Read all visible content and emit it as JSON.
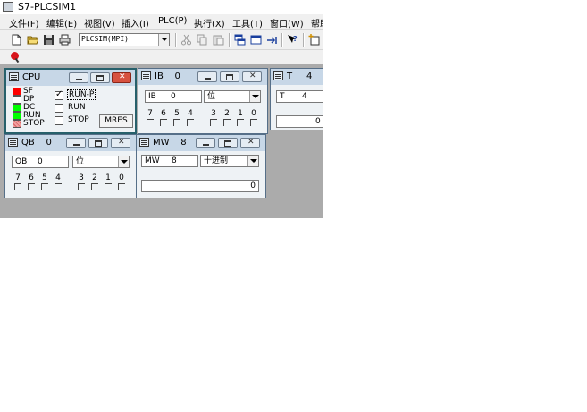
{
  "app": {
    "title": "S7-PLCSIM1",
    "menu": [
      "文件(F)",
      "编辑(E)",
      "视图(V)",
      "插入(I)",
      "PLC(P)",
      "执行(X)",
      "工具(T)",
      "窗口(W)",
      "帮助"
    ],
    "toolbar": {
      "access_path": "PLCSIM(MPI)",
      "icons": [
        "new-icon",
        "open-icon",
        "save-icon",
        "print-icon",
        "cut-icon",
        "copy-icon",
        "paste-icon",
        "cascade-icon",
        "tile-icon",
        "dock-icon",
        "help-icon",
        "insert-icon",
        "pin-icon"
      ]
    }
  },
  "cpu": {
    "title": "CPU",
    "leds": [
      {
        "label": "SF",
        "color": "#ff0000"
      },
      {
        "label": "DP",
        "color": "#ffffff"
      },
      {
        "label": "DC",
        "color": "#00ff00"
      },
      {
        "label": "RUN",
        "color": "#00ff00"
      },
      {
        "label": "STOP",
        "color": "#f0a0a0"
      }
    ],
    "modes": [
      {
        "label": "RUN-P",
        "checked": true
      },
      {
        "label": "RUN",
        "checked": false
      },
      {
        "label": "STOP",
        "checked": false
      }
    ],
    "mres_label": "MRES"
  },
  "ib": {
    "title_type": "IB",
    "title_index": "0",
    "addr_type": "IB",
    "addr_index": "0",
    "format": "位",
    "bits": [
      "7",
      "6",
      "5",
      "4",
      "3",
      "2",
      "1",
      "0"
    ]
  },
  "t": {
    "title_type": "T",
    "title_index": "4",
    "addr_type": "T",
    "addr_index": "4",
    "value": "0"
  },
  "qb": {
    "title_type": "QB",
    "title_index": "0",
    "addr_type": "QB",
    "addr_index": "0",
    "format": "位",
    "bits": [
      "7",
      "6",
      "5",
      "4",
      "3",
      "2",
      "1",
      "0"
    ]
  },
  "mw": {
    "title_type": "MW",
    "title_index": "8",
    "addr_type": "MW",
    "addr_index": "8",
    "format": "十进制",
    "value": "0"
  }
}
